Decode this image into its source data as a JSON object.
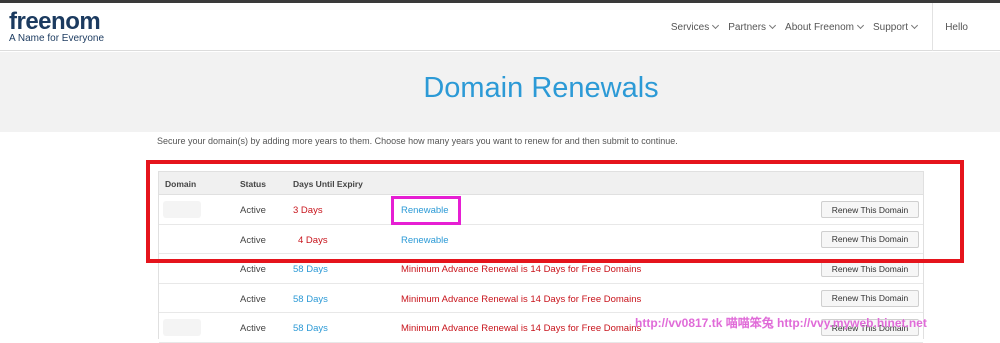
{
  "logo": {
    "word": "freenom",
    "tagline": "A Name for Everyone"
  },
  "nav": {
    "items": [
      {
        "label": "Services"
      },
      {
        "label": "Partners"
      },
      {
        "label": "About Freenom"
      },
      {
        "label": "Support"
      }
    ],
    "hello": "Hello"
  },
  "hero": {
    "title": "Domain Renewals"
  },
  "intro": "Secure your domain(s) by adding more years to them. Choose how many years you want to renew for and then submit to continue.",
  "table": {
    "headers": {
      "domain": "Domain",
      "status": "Status",
      "days": "Days Until Expiry"
    },
    "rows": [
      {
        "status": "Active",
        "days": "3 Days",
        "note": "Renewable",
        "button": "Renew This Domain"
      },
      {
        "status": "Active",
        "days": "4 Days",
        "note": "Renewable",
        "button": "Renew This Domain"
      },
      {
        "status": "Active",
        "days": "58 Days",
        "note": "Minimum Advance Renewal is 14 Days for Free Domains",
        "button": "Renew This Domain"
      },
      {
        "status": "Active",
        "days": "58 Days",
        "note": "Minimum Advance Renewal is 14 Days for Free Domains",
        "button": "Renew This Domain"
      },
      {
        "status": "Active",
        "days": "58 Days",
        "note": "Minimum Advance Renewal is 14 Days for Free Domains",
        "button": "Renew This Domain"
      }
    ]
  },
  "watermark": "http://vv0817.tk 喵喵笨兔 http://vvy.myweb.hinet.net",
  "colors": {
    "accent": "#2c9ad6",
    "danger": "#c8141c",
    "highlight_red": "#e5141c",
    "highlight_magenta": "#e61fd3"
  }
}
